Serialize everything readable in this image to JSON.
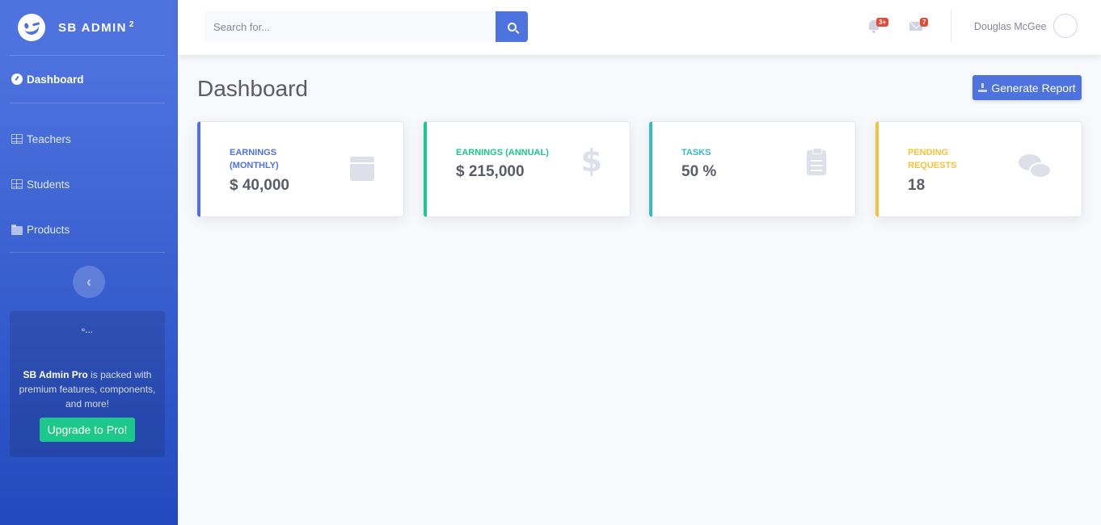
{
  "brand": {
    "name": "SB ADMIN",
    "superscript": "2"
  },
  "sidebar": {
    "items": [
      {
        "label": "Dashboard",
        "icon": "gauge-icon",
        "active": true
      },
      {
        "label": "Teachers",
        "icon": "table-icon"
      },
      {
        "label": "Students",
        "icon": "table-icon"
      },
      {
        "label": "Products",
        "icon": "folder-icon"
      }
    ],
    "toggle_icon": "chevron-left-icon",
    "promo": {
      "image_alt": "...",
      "strong_text": "SB Admin Pro",
      "text": " is packed with premium features, components, and more!",
      "button_label": "Upgrade to Pro!"
    }
  },
  "topbar": {
    "search": {
      "placeholder": "Search for...",
      "value": ""
    },
    "alerts_badge": "3+",
    "messages_badge": "7",
    "user_name": "Douglas McGee"
  },
  "main": {
    "title": "Dashboard",
    "report_button": "Generate Report",
    "cards": [
      {
        "label": "Earnings (Monthly)",
        "value": "$ 40,000",
        "color": "#4e73df",
        "icon": "calendar-icon"
      },
      {
        "label": "Earnings (Annual)",
        "value": "$ 215,000",
        "color": "#1cc88a",
        "icon": "dollar-icon"
      },
      {
        "label": "Tasks",
        "value": "50 %",
        "color": "#36b9cc",
        "icon": "clipboard-icon"
      },
      {
        "label": "Pending Requests",
        "value": "18",
        "color": "#f6c23e",
        "icon": "comments-icon"
      }
    ]
  },
  "colors": {
    "primary": "#4e73df",
    "success": "#1cc88a",
    "info": "#36b9cc",
    "warning": "#f6c23e",
    "danger": "#e74a3b"
  }
}
